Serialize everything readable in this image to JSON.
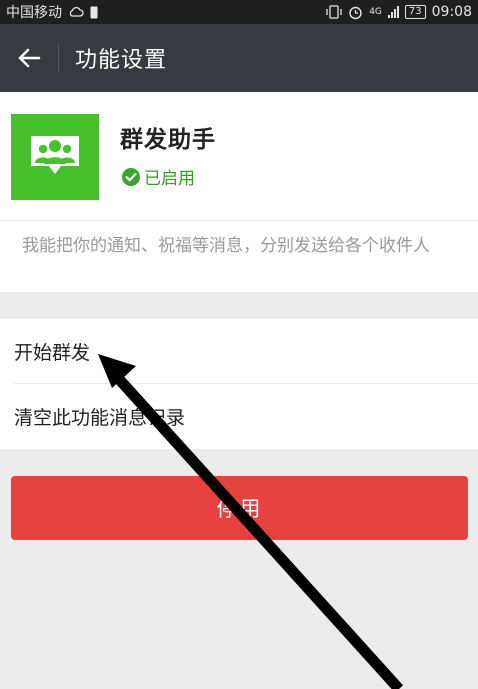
{
  "status_bar": {
    "carrier": "中国移动",
    "network": "4G",
    "battery": "73",
    "time": "09:08"
  },
  "header": {
    "title": "功能设置"
  },
  "profile": {
    "name": "群发助手",
    "status": "已启用",
    "icon_color": "#46c02b"
  },
  "description": "我能把你的通知、祝福等消息，分别发送给各个收件人",
  "menu": [
    {
      "label": "开始群发"
    },
    {
      "label": "清空此功能消息记录"
    }
  ],
  "actions": {
    "disable_label": "停用",
    "disable_color": "#e64340"
  }
}
